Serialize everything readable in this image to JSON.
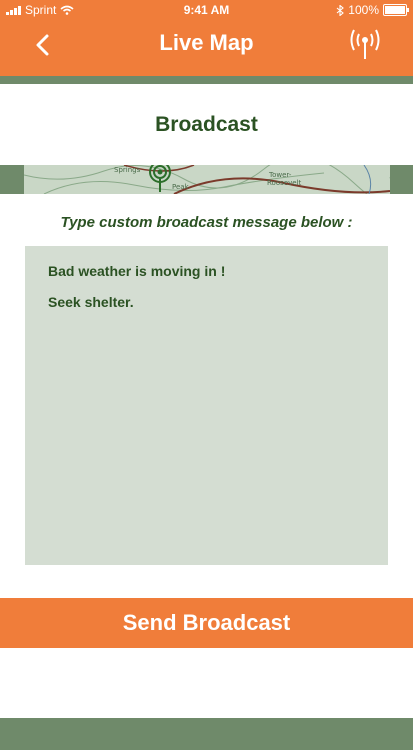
{
  "status_bar": {
    "carrier": "Sprint",
    "time": "9:41 AM",
    "battery": "100%"
  },
  "header": {
    "title": "Live Map",
    "back_icon": "chevron-left-icon",
    "broadcast_icon": "radio-tower-icon"
  },
  "panel": {
    "title": "Broadcast"
  },
  "map_labels": [
    "Springs",
    "Peak",
    "Tower-",
    "Roosevelt"
  ],
  "broadcast": {
    "prompt": "Type custom broadcast message below :",
    "message_lines": [
      "Bad weather is moving in !",
      "Seek shelter."
    ],
    "send_label": "Send Broadcast"
  },
  "colors": {
    "accent": "#f07d3a",
    "green_text": "#2b5223",
    "background": "#6f8a6a",
    "message_box": "#d4ddd2"
  }
}
